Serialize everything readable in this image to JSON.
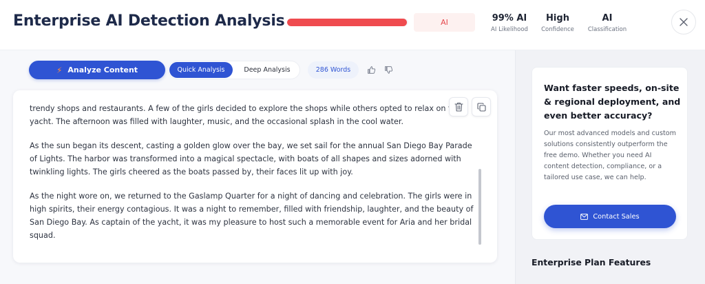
{
  "header": {
    "title": "Enterprise AI Detection Analysis",
    "ai_likelihood_fraction": 0.99,
    "verdict_chip": "AI",
    "stats": [
      {
        "value": "99% AI",
        "label": "AI Likelihood"
      },
      {
        "value": "High",
        "label": "Confidence"
      },
      {
        "value": "AI",
        "label": "Classification"
      }
    ],
    "close_icon": "close-icon"
  },
  "toolbar": {
    "analyze_label": "Analyze Content",
    "analyze_icon": "lightning-icon",
    "quick_label": "Quick Analysis",
    "deep_label": "Deep Analysis",
    "word_count": "286 Words",
    "thumbs_up_icon": "thumbs-up-icon",
    "thumbs_down_icon": "thumbs-down-icon"
  },
  "content": {
    "paragraphs": [
      "trendy shops and restaurants. A few of the girls decided to explore the shops while others opted to relax on the yacht. The afternoon was filled with laughter, music, and the occasional splash in the cool water.",
      "As the sun began its descent, casting a golden glow over the bay, we set sail for the annual San Diego Bay Parade of Lights. The harbor was transformed into a magical spectacle, with boats of all shapes and sizes adorned with twinkling lights. The girls cheered as the boats passed by, their faces lit up with joy.",
      "As the night wore on, we returned to the Gaslamp Quarter for a night of dancing and celebration. The girls were in high spirits, their energy contagious. It was a night to remember, filled with friendship, laughter, and the beauty of San Diego Bay. As captain of the yacht, it was my pleasure to host such a memorable event for Aria and her bridal squad."
    ],
    "delete_icon": "trash-icon",
    "copy_icon": "copy-icon"
  },
  "promo": {
    "heading": "Want faster speeds, on-site & regional deployment, and even better accuracy?",
    "body": "Our most advanced models and custom solutions consistently outperform the free demo. Whether you need AI content detection, compliance, or a tailored use case, we can help.",
    "button_label": "Contact Sales",
    "button_icon": "mail-icon"
  },
  "features": {
    "title": "Enterprise Plan Features"
  },
  "colors": {
    "accent": "#2f54d3",
    "danger": "#ef4b4f",
    "title": "#1e2a4a"
  }
}
